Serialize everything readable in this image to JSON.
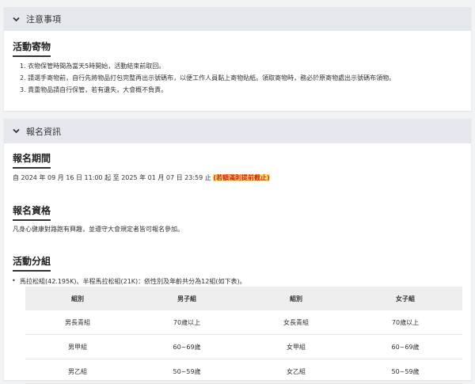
{
  "notice": {
    "header": "注意事項",
    "title": "活動寄物",
    "items": [
      "1. 衣物保管時間為當天5時開始，活動結束前取回。",
      "2. 請選手寄物前，自行先將物品打包完整再出示號碼布，以便工作人員黏上寄物貼紙。領取寄物時，務必於原寄物處出示號碼布領物。",
      "3. 貴重物品請自行保管，若有遺失，大會概不負責。"
    ]
  },
  "registration": {
    "header": "報名資訊",
    "period_title": "報名期間",
    "period_text": "自 2024 年 09 月 16 日 11:00 起 至 2025 年 01 月 07 日 23:59 止",
    "period_note": "(若額滿則提前截止)",
    "qual_title": "報名資格",
    "qual_text": "凡身心健康對路跑有興趣，並遵守大會規定者皆可報名參加。",
    "groups_title": "活動分組",
    "groups_bullet": "馬拉松組(42.195K)、半程馬拉松組(21K)：依性別及年齡共分為12組(如下表)。",
    "table": {
      "headers": [
        "組別",
        "男子組",
        "組別",
        "女子組"
      ],
      "rows": [
        [
          "男長青組",
          "70歲以上",
          "女長青組",
          "70歲以上"
        ],
        [
          "男甲組",
          "60~69歲",
          "女甲組",
          "60~69歲"
        ],
        [
          "男乙組",
          "50~59歲",
          "女乙組",
          "50~59歲"
        ]
      ]
    }
  },
  "colors": {
    "header_bg": "#e4e7eb",
    "highlight_bg": "#ffe46b",
    "highlight_text": "#d0211c"
  },
  "icons": {
    "collapse": "chevron-down-icon"
  }
}
